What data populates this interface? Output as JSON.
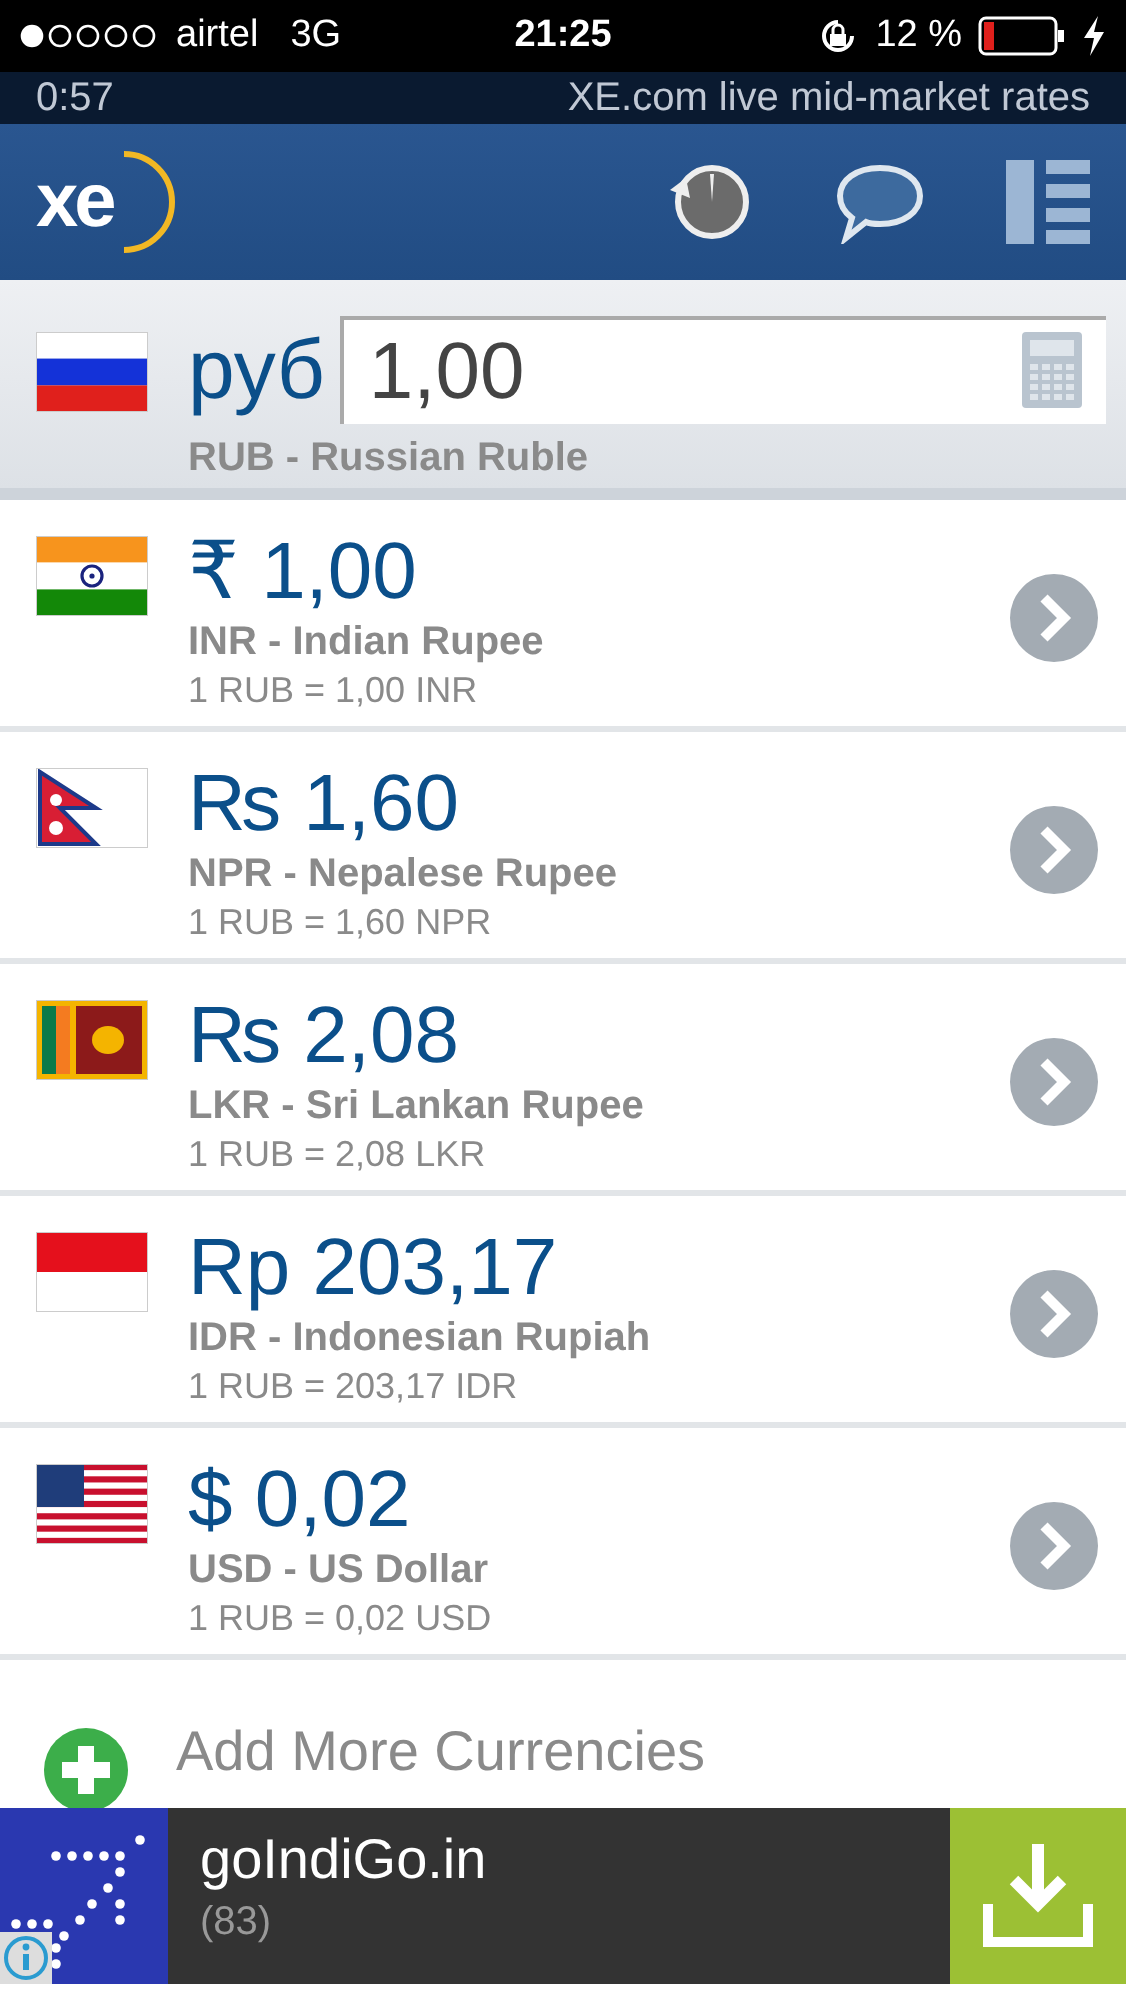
{
  "status_bar": {
    "carrier": "airtel",
    "network": "3G",
    "time": "21:25",
    "battery": "12 %"
  },
  "info_bar": {
    "timer": "0:57",
    "tagline": "XE.com live mid-market rates"
  },
  "header": {
    "logo": "xe"
  },
  "base": {
    "kind": "ru",
    "symbol": "руб",
    "value": "1,00",
    "name": "RUB - Russian Ruble"
  },
  "currencies": [
    {
      "kind": "in",
      "amount": "₹ 1,00",
      "name": "INR - Indian Rupee",
      "rate": "1 RUB = 1,00 INR"
    },
    {
      "kind": "np",
      "amount": "₨ 1,60",
      "name": "NPR - Nepalese Rupee",
      "rate": "1 RUB = 1,60 NPR"
    },
    {
      "kind": "lk",
      "amount": "₨ 2,08",
      "name": "LKR - Sri Lankan Rupee",
      "rate": "1 RUB = 2,08 LKR"
    },
    {
      "kind": "id",
      "amount": "Rp 203,17",
      "name": "IDR - Indonesian Rupiah",
      "rate": "1 RUB = 203,17 IDR"
    },
    {
      "kind": "us",
      "amount": "$ 0,02",
      "name": "USD - US Dollar",
      "rate": "1 RUB = 0,02 USD"
    }
  ],
  "add_more": {
    "label": "Add More Currencies"
  },
  "ad": {
    "title": "goIndiGo.in",
    "rating_count": "(83)"
  }
}
